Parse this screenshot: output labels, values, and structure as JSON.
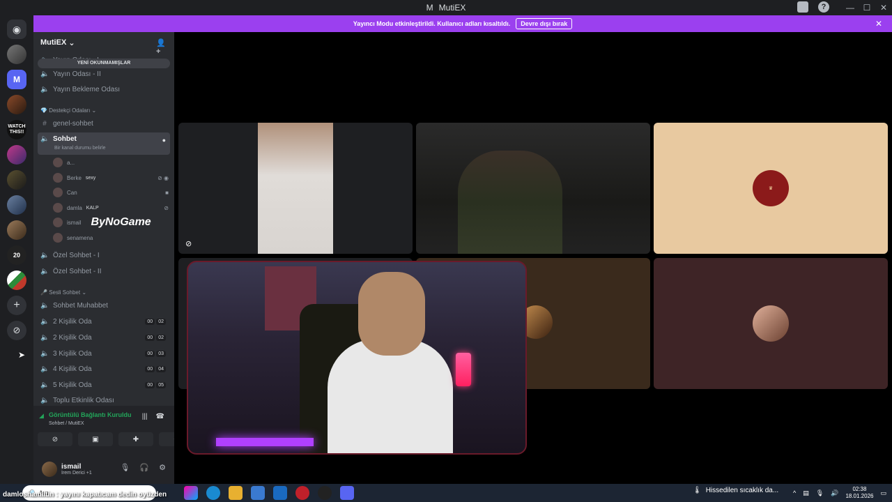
{
  "titlebar": {
    "logo": "M",
    "title": "MutiEX"
  },
  "banner": {
    "text": "Yayıncı Modu etkinleştirildi. Kullanıcı adları kısaltıldı.",
    "button": "Devre dışı bırak"
  },
  "guilds": {
    "active_initial": "M",
    "watch_label": "WATCH THIS!!",
    "badge_20": "20"
  },
  "server": {
    "name": "MutiEX",
    "unread_label": "YENİ OKUNMAMIŞLAR"
  },
  "channels_top": [
    {
      "label": "Yayın Odası - I"
    },
    {
      "label": "Yayın Odası - II"
    },
    {
      "label": "Yayın Bekleme Odası"
    }
  ],
  "category_supporter": "Destekçi Odaları",
  "text_channel": "genel-sohbet",
  "active_channel": {
    "label": "Sohbet",
    "status": "Bir kanal durumu belirle"
  },
  "voice_users": [
    {
      "name": "a..."
    },
    {
      "name": "Berke",
      "tag": "sexy"
    },
    {
      "name": "Can"
    },
    {
      "name": "damla",
      "tag": "KALP"
    },
    {
      "name": "ismail",
      "sponsor": "ByNoGame"
    },
    {
      "name": "senamena"
    }
  ],
  "private_channels": [
    {
      "label": "Özel Sohbet - I"
    },
    {
      "label": "Özel Sohbet - II"
    }
  ],
  "category_voice": "Sesli Sohbet",
  "voice_channels": [
    {
      "label": "Sohbet Muhabbet"
    },
    {
      "label": "2 Kişilik Oda",
      "c1": "00",
      "c2": "02"
    },
    {
      "label": "2 Kişilik Oda",
      "c1": "00",
      "c2": "02"
    },
    {
      "label": "3 Kişilik Oda",
      "c1": "00",
      "c2": "03"
    },
    {
      "label": "4 Kişilik Oda",
      "c1": "00",
      "c2": "04"
    },
    {
      "label": "5 Kişilik Oda",
      "c1": "00",
      "c2": "05"
    },
    {
      "label": "Toplu Etkinlik Odası"
    }
  ],
  "voice_panel": {
    "status": "Görüntülü Bağlantı Kuruldu",
    "location": "Sohbet / MutiEX"
  },
  "user": {
    "name": "ismail",
    "activity": "İrem Derici +1"
  },
  "taskbar": {
    "overlay": "damloshamiltin : yayını kapatıcam dedin oyüzden",
    "search_placeholder": "Ara",
    "weather": "Hissedilen sıcaklık da...",
    "time": "02:38",
    "date": "18.01.2026"
  },
  "colors": {
    "banner": "#9b40ef",
    "accent": "#5865f2",
    "connected": "#23a55a"
  }
}
